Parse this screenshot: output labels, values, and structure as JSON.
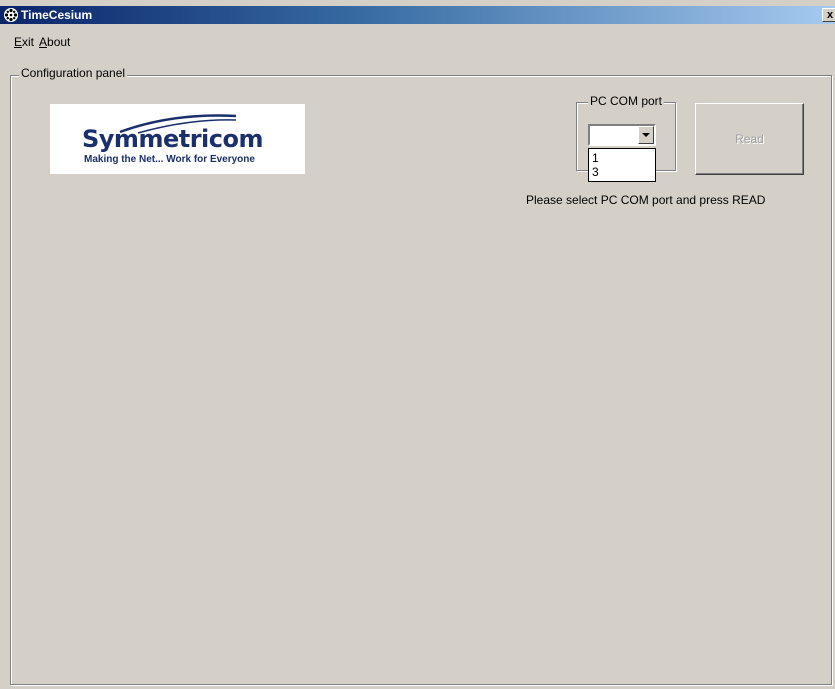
{
  "window": {
    "title": "TimeCesium",
    "close_label": "x"
  },
  "menu": {
    "exit": "Exit",
    "about": "About"
  },
  "config_panel": {
    "legend": "Configuration panel"
  },
  "logo": {
    "wordmark": "Symmetricom",
    "tagline": "Making the Net... Work for Everyone",
    "color": "#1b2f6b"
  },
  "com_port": {
    "legend": "PC COM port",
    "selected_value": "",
    "options": [
      "1",
      "3"
    ]
  },
  "read_button": {
    "label": "Read",
    "enabled": false
  },
  "status": {
    "message": "Please select PC COM port and press READ"
  },
  "icons": {
    "app": "gear-icon",
    "dropdown": "chevron-down-icon"
  }
}
